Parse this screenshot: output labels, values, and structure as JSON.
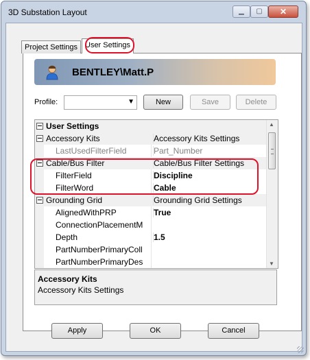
{
  "window": {
    "title": "3D Substation Layout"
  },
  "tabs": [
    {
      "label": "Project Settings",
      "selected": false
    },
    {
      "label": "User Settings",
      "selected": true
    }
  ],
  "user": {
    "name": "BENTLEY\\Matt.P",
    "icon": "user-icon"
  },
  "profile": {
    "label": "Profile:",
    "value": "",
    "new_label": "New",
    "save_label": "Save",
    "delete_label": "Delete"
  },
  "grid": {
    "section": "User Settings",
    "rows": [
      {
        "name": "Accessory Kits",
        "value": "Accessory Kits Settings",
        "kind": "category"
      },
      {
        "name": "LastUsedFilterField",
        "value": "Part_Number",
        "kind": "property-readonly"
      },
      {
        "name": "Cable/Bus Filter",
        "value": "Cable/Bus Filter Settings",
        "kind": "category"
      },
      {
        "name": "FilterField",
        "value": "Discipline",
        "kind": "property-bold"
      },
      {
        "name": "FilterWord",
        "value": "Cable",
        "kind": "property-bold"
      },
      {
        "name": "Grounding Grid",
        "value": "Grounding Grid Settings",
        "kind": "category"
      },
      {
        "name": "AlignedWithPRP",
        "value": "True",
        "kind": "property-bold"
      },
      {
        "name": "ConnectionPlacementM",
        "value": "",
        "kind": "property"
      },
      {
        "name": "Depth",
        "value": "1.5",
        "kind": "property-bold"
      },
      {
        "name": "PartNumberPrimaryColl",
        "value": "",
        "kind": "property"
      },
      {
        "name": "PartNumberPrimaryDes",
        "value": "",
        "kind": "property"
      }
    ]
  },
  "description": {
    "title": "Accessory Kits",
    "text": "Accessory Kits Settings"
  },
  "footer": {
    "apply_label": "Apply",
    "ok_label": "OK",
    "cancel_label": "Cancel"
  },
  "colors": {
    "highlight": "#e0102a",
    "header_gradient_start": "#7f97b5",
    "header_gradient_end": "#f0c89b"
  }
}
